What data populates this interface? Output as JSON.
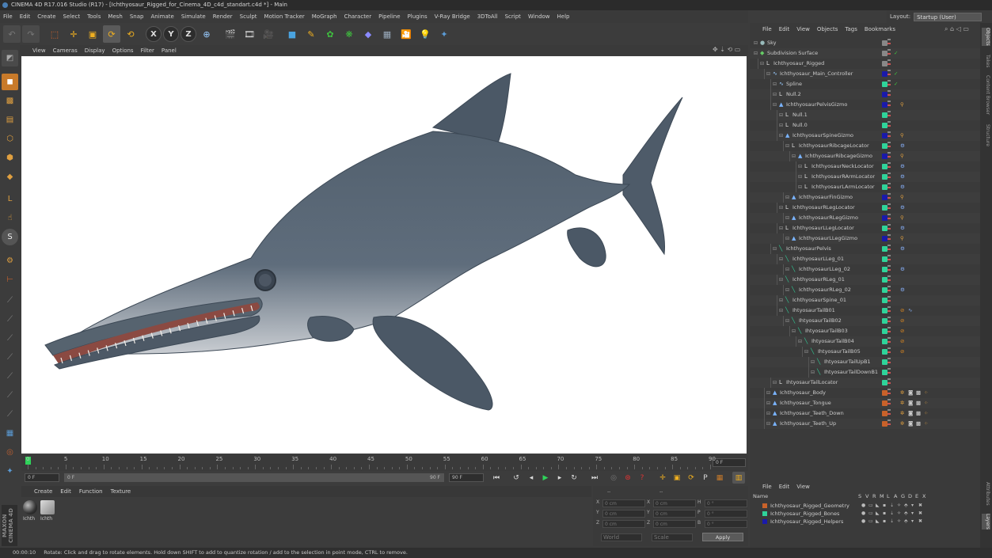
{
  "window": {
    "title": "CINEMA 4D R17.016 Studio (R17) - [Ichthyosaur_Rigged_for_Cinema_4D_c4d_standart.c4d *] - Main"
  },
  "menu": [
    "File",
    "Edit",
    "Create",
    "Select",
    "Tools",
    "Mesh",
    "Snap",
    "Animate",
    "Simulate",
    "Render",
    "Sculpt",
    "Motion Tracker",
    "MoGraph",
    "Character",
    "Pipeline",
    "Plugins",
    "V-Ray Bridge",
    "3DToAll",
    "Script",
    "Window",
    "Help"
  ],
  "layout": {
    "label": "Layout:",
    "value": "Startup (User)"
  },
  "toolbar": {
    "axis_x": "X",
    "axis_y": "Y",
    "axis_z": "Z"
  },
  "viewport_menu": [
    "View",
    "Cameras",
    "Display",
    "Options",
    "Filter",
    "Panel"
  ],
  "timeline": {
    "ticks": [
      "0",
      "5",
      "10",
      "15",
      "20",
      "25",
      "30",
      "35",
      "40",
      "45",
      "50",
      "55",
      "60",
      "65",
      "70",
      "75",
      "80",
      "85",
      "90"
    ],
    "current_frame": "0 F",
    "start": "0 F",
    "range_start": "0 F",
    "range_end": "90 F",
    "end": "90 F"
  },
  "material_manager": {
    "menu": [
      "Create",
      "Edit",
      "Function",
      "Texture"
    ],
    "materials": [
      {
        "label": "Ichth"
      },
      {
        "label": "Ichth"
      }
    ]
  },
  "coordinates": {
    "rows": [
      {
        "a": "X",
        "av": "0 cm",
        "b": "X",
        "bv": "0 cm",
        "c": "H",
        "cv": "0 °"
      },
      {
        "a": "Y",
        "av": "0 cm",
        "b": "Y",
        "bv": "0 cm",
        "c": "P",
        "cv": "0 °"
      },
      {
        "a": "Z",
        "av": "0 cm",
        "b": "Z",
        "bv": "0 cm",
        "c": "B",
        "cv": "0 °"
      }
    ],
    "mode": "World",
    "scale": "Scale",
    "apply": "Apply",
    "header": "--"
  },
  "status": {
    "time": "00:00:10",
    "message": "Rotate: Click and drag to rotate elements. Hold down SHIFT to add to quantize rotation / add to the selection in point mode, CTRL to remove."
  },
  "object_manager": {
    "menu": [
      "File",
      "Edit",
      "View",
      "Objects",
      "Tags",
      "Bookmarks"
    ],
    "objects": [
      {
        "name": "Sky",
        "indent": 0,
        "icon": "sky",
        "color": "#888888"
      },
      {
        "name": "Subdivision Surface",
        "indent": 0,
        "icon": "subdiv",
        "color": "#888888",
        "check": true
      },
      {
        "name": "Ichthyosaur_Rigged",
        "indent": 1,
        "icon": "null",
        "color": "#888888"
      },
      {
        "name": "Ichthyosaur_Main_Controller",
        "indent": 2,
        "icon": "spline",
        "color": "#1a1aaa",
        "check": true
      },
      {
        "name": "Spline",
        "indent": 3,
        "icon": "spline",
        "color": "#2fd39a",
        "check": true
      },
      {
        "name": "Null.2",
        "indent": 3,
        "icon": "null",
        "color": "#1a1aaa"
      },
      {
        "name": "IchthyosaurPelvisGizmo",
        "indent": 3,
        "icon": "joint",
        "color": "#1a1aaa",
        "tag": "ik"
      },
      {
        "name": "Null.1",
        "indent": 4,
        "icon": "null",
        "color": "#2fd39a"
      },
      {
        "name": "Null.0",
        "indent": 4,
        "icon": "null",
        "color": "#2fd39a"
      },
      {
        "name": "IchthyosaurSpineGizmo",
        "indent": 4,
        "icon": "joint",
        "color": "#1a1aaa",
        "tag": "ik"
      },
      {
        "name": "IchthyosaurRibcageLocator",
        "indent": 5,
        "icon": "null",
        "color": "#2fd39a",
        "tag": "con"
      },
      {
        "name": "IchthyosaurRibcageGizmo",
        "indent": 6,
        "icon": "joint",
        "color": "#1a1aaa",
        "tag": "ik"
      },
      {
        "name": "IchthyosaurNeckLocator",
        "indent": 7,
        "icon": "null",
        "color": "#2fd39a",
        "tag": "con"
      },
      {
        "name": "IchthyosaurRArmLocator",
        "indent": 7,
        "icon": "null",
        "color": "#2fd39a",
        "tag": "con"
      },
      {
        "name": "IchthyosaurLArmLocator",
        "indent": 7,
        "icon": "null",
        "color": "#2fd39a",
        "tag": "con"
      },
      {
        "name": "IchthyosaurFinGizmo",
        "indent": 5,
        "icon": "joint",
        "color": "#1a1aaa",
        "tag": "ik"
      },
      {
        "name": "IchthyosaurRLegLocator",
        "indent": 4,
        "icon": "null",
        "color": "#2fd39a",
        "tag": "con"
      },
      {
        "name": "IchthyosaurRLegGizmo",
        "indent": 5,
        "icon": "joint",
        "color": "#1a1aaa",
        "tag": "ik"
      },
      {
        "name": "IchthyosaurLLegLocator",
        "indent": 4,
        "icon": "null",
        "color": "#2fd39a",
        "tag": "con"
      },
      {
        "name": "IchthyosaurLLegGizmo",
        "indent": 5,
        "icon": "joint",
        "color": "#1a1aaa",
        "tag": "ik"
      },
      {
        "name": "IchthyosaurPelvis",
        "indent": 3,
        "icon": "bone",
        "color": "#2fd39a",
        "tag": "con"
      },
      {
        "name": "IchthyosaurLLeg_01",
        "indent": 4,
        "icon": "bone",
        "color": "#2fd39a"
      },
      {
        "name": "IchthyosaurLLeg_02",
        "indent": 5,
        "icon": "bone",
        "color": "#2fd39a",
        "tag": "con"
      },
      {
        "name": "IchthyosaurRLeg_01",
        "indent": 4,
        "icon": "bone",
        "color": "#2fd39a"
      },
      {
        "name": "IchthyosaurRLeg_02",
        "indent": 5,
        "icon": "bone",
        "color": "#2fd39a",
        "tag": "con"
      },
      {
        "name": "IchthyosaurSpine_01",
        "indent": 4,
        "icon": "bone",
        "color": "#2fd39a"
      },
      {
        "name": "IhtyosaurTailB01",
        "indent": 4,
        "icon": "bone",
        "color": "#2fd39a",
        "tag": "noz2"
      },
      {
        "name": "IhtyosaurTailB02",
        "indent": 5,
        "icon": "bone",
        "color": "#2fd39a",
        "tag": "noz"
      },
      {
        "name": "IhtyosaurTailB03",
        "indent": 6,
        "icon": "bone",
        "color": "#2fd39a",
        "tag": "noz"
      },
      {
        "name": "IhtyosaurTailB04",
        "indent": 7,
        "icon": "bone",
        "color": "#2fd39a",
        "tag": "noz"
      },
      {
        "name": "IhtyosaurTailB05",
        "indent": 8,
        "icon": "bone",
        "color": "#2fd39a",
        "tag": "noz"
      },
      {
        "name": "IhtyosaurTailUpB1",
        "indent": 9,
        "icon": "bone",
        "color": "#2fd39a"
      },
      {
        "name": "IhtyosaurTailDownB1",
        "indent": 9,
        "icon": "bone",
        "color": "#2fd39a"
      },
      {
        "name": "IhtyosaurTailLocator",
        "indent": 3,
        "icon": "null",
        "color": "#2fd39a"
      },
      {
        "name": "Ichthyosaur_Body",
        "indent": 2,
        "icon": "joint",
        "color": "#c8622a",
        "tag": "mat"
      },
      {
        "name": "Ichthyosaur_Tongue",
        "indent": 2,
        "icon": "joint",
        "color": "#c8622a",
        "tag": "mat"
      },
      {
        "name": "Ichthyosaur_Teeth_Down",
        "indent": 2,
        "icon": "joint",
        "color": "#c8622a",
        "tag": "mat"
      },
      {
        "name": "Ichthyosaur_Teeth_Up",
        "indent": 2,
        "icon": "joint",
        "color": "#c8622a",
        "tag": "mat"
      }
    ]
  },
  "layer_manager": {
    "menu": [
      "File",
      "Edit",
      "View"
    ],
    "headers": [
      "Name",
      "S",
      "V",
      "R",
      "M",
      "L",
      "A",
      "G",
      "D",
      "E",
      "X"
    ],
    "layers": [
      {
        "name": "Ichthyosaur_Rigged_Geometry",
        "color": "#c8622a"
      },
      {
        "name": "Ichthyosaur_Rigged_Bones",
        "color": "#2fd39a"
      },
      {
        "name": "Ichthyosaur_Rigged_Helpers",
        "color": "#1a1aaa"
      }
    ]
  },
  "side_tabs": [
    "Objects",
    "Takes",
    "Content Browser",
    "Structure",
    "Attributes",
    "Layers"
  ]
}
